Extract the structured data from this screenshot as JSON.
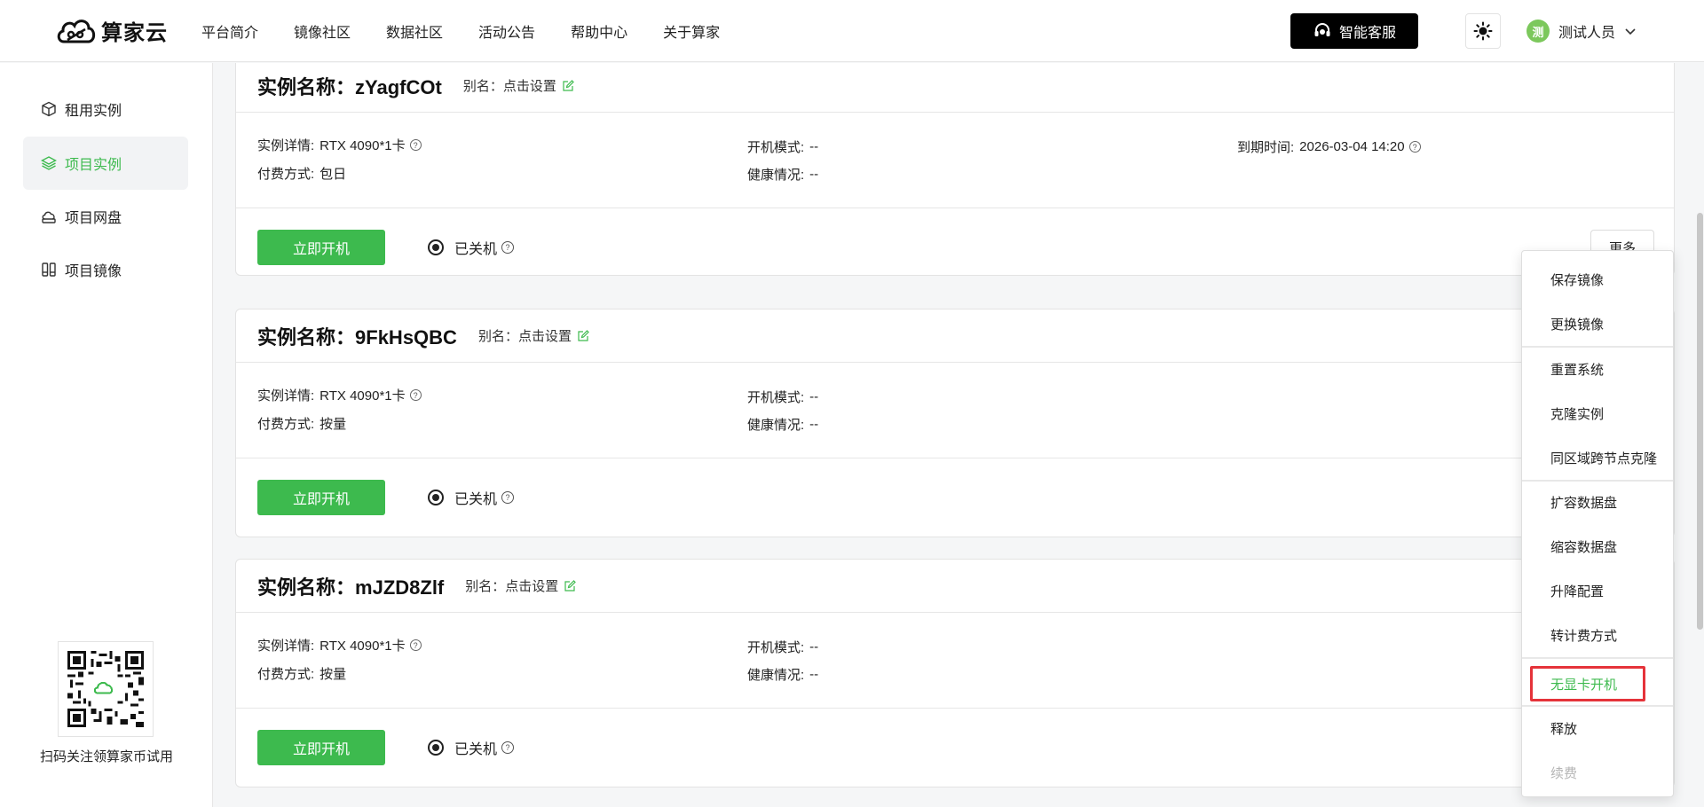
{
  "brand": {
    "name": "算家云"
  },
  "nav": [
    "平台简介",
    "镜像社区",
    "数据社区",
    "活动公告",
    "帮助中心",
    "关于算家"
  ],
  "header": {
    "service_label": "智能客服",
    "user_avatar": "测",
    "user_name": "测试人员"
  },
  "sidebar": {
    "items": [
      {
        "label": "租用实例",
        "icon": "cube-icon",
        "active": false
      },
      {
        "label": "项目实例",
        "icon": "layers-icon",
        "active": true
      },
      {
        "label": "项目网盘",
        "icon": "cloud-drive-icon",
        "active": false
      },
      {
        "label": "项目镜像",
        "icon": "image-icon",
        "active": false
      }
    ],
    "qr_caption": "扫码关注领算家币试用"
  },
  "labels": {
    "instance_name_prefix": "实例名称：",
    "alias": "别名：",
    "alias_action": "点击设置",
    "detail": "实例详情:",
    "boot_mode": "开机模式:",
    "expire": "到期时间:",
    "pay": "付费方式:",
    "health": "健康情况:",
    "start": "立即开机",
    "status": "已关机",
    "more": "更多"
  },
  "instances": [
    {
      "name": "zYagfCOt",
      "detail": "RTX 4090*1卡",
      "boot_mode": "--",
      "expire": "2026-03-04 14:20",
      "pay": "包日",
      "health": "--"
    },
    {
      "name": "9FkHsQBC",
      "detail": "RTX 4090*1卡",
      "boot_mode": "--",
      "pay": "按量",
      "health": "--"
    },
    {
      "name": "mJZD8Zlf",
      "detail": "RTX 4090*1卡",
      "boot_mode": "--",
      "pay": "按量",
      "health": "--"
    }
  ],
  "dropdown": {
    "items": [
      "保存镜像",
      "更换镜像",
      "重置系统",
      "克隆实例",
      "同区域跨节点克隆",
      "扩容数据盘",
      "缩容数据盘",
      "升降配置",
      "转计费方式",
      "无显卡开机",
      "释放",
      "续费"
    ]
  },
  "colors": {
    "accent": "#3dba4e",
    "highlight_border": "#e5333a",
    "disabled": "#b5b5b5"
  }
}
